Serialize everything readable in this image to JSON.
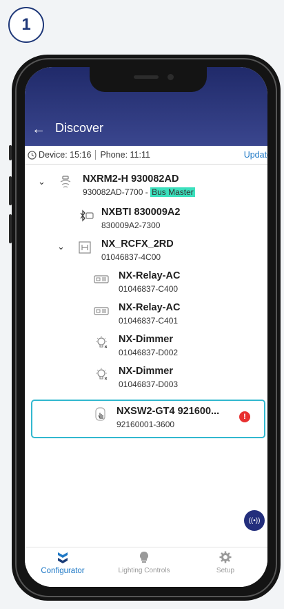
{
  "step": {
    "number": "1"
  },
  "header": {
    "title": "Discover",
    "back_icon": "back-arrow-icon"
  },
  "timebar": {
    "device": "Device: 15:16",
    "phone": "Phone: 11:11",
    "update": "Update"
  },
  "tree": [
    {
      "name": "NXRM2-H 930082AD",
      "id": "930082AD-7700 -",
      "badge": "Bus Master",
      "icon": "radio-module-icon",
      "expanded": true
    },
    {
      "name": "NXBTI 830009A2",
      "id": "830009A2-7300",
      "icon": "bluetooth-interface-icon"
    },
    {
      "name": "NX_RCFX_2RD",
      "id": "01046837-4C00",
      "icon": "fixture-controller-icon",
      "expanded": true
    },
    {
      "name": "NX-Relay-AC",
      "id": "01046837-C400",
      "icon": "relay-icon"
    },
    {
      "name": "NX-Relay-AC",
      "id": "01046837-C401",
      "icon": "relay-icon"
    },
    {
      "name": "NX-Dimmer",
      "id": "01046837-D002",
      "icon": "dimmer-bulb-icon"
    },
    {
      "name": "NX-Dimmer",
      "id": "01046837-D003",
      "icon": "dimmer-bulb-icon"
    },
    {
      "name": "NXSW2-GT4 921600...",
      "id": "92160001-3600",
      "icon": "wallstation-touch-icon",
      "alert": "!"
    }
  ],
  "tabs": [
    {
      "label": "Configurator",
      "icon": "configurator-icon",
      "active": true
    },
    {
      "label": "Lighting Controls",
      "icon": "lightbulb-icon",
      "active": false
    },
    {
      "label": "Setup",
      "icon": "gear-icon",
      "active": false
    }
  ],
  "fab": {
    "icon": "broadcast-icon",
    "glyph": "((•))"
  },
  "colors": {
    "header": "#2a3580",
    "accent": "#1f79c6",
    "highlight": "#32b8cf",
    "bus_master": "#3be0bd",
    "alert": "#e83030"
  }
}
